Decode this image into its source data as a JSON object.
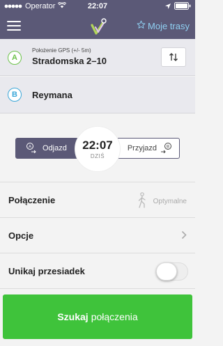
{
  "statusbar": {
    "carrier": "Operator",
    "time": "22:07"
  },
  "navbar": {
    "my_routes_label": "Moje trasy"
  },
  "route": {
    "start": {
      "marker": "A",
      "hint": "Położenie GPS (+/- 5m)",
      "address": "Stradomska 2–10"
    },
    "end": {
      "marker": "B",
      "address": "Reymana"
    }
  },
  "time_selector": {
    "departure_label": "Odjazd",
    "arrival_label": "Przyjazd",
    "time": "22:07",
    "day": "DZIŚ",
    "selected": "departure"
  },
  "options": {
    "connection_label": "Połączenie",
    "connection_value": "Optymalne",
    "options_label": "Opcje",
    "avoid_transfers_label": "Unikaj przesiadek",
    "avoid_transfers_on": false
  },
  "search_button": {
    "bold": "Szukaj",
    "rest": "połączenia"
  },
  "colors": {
    "header": "#5b5977",
    "accent_blue": "#8fd0f2",
    "marker_a": "#6cc24a",
    "marker_b": "#3ba7d8",
    "search_green": "#3fc33b"
  }
}
